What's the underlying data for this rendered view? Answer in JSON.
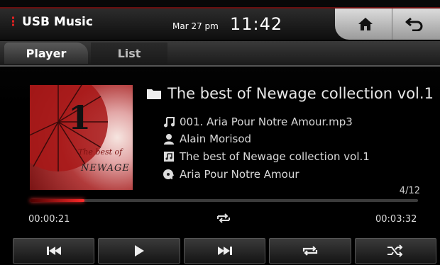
{
  "header": {
    "app_title": "USB Music",
    "date": "Mar 27 pm",
    "time": "11:42",
    "home_icon": "home-icon",
    "back_icon": "back-arrow-icon"
  },
  "tabs": [
    {
      "label": "Player",
      "active": true
    },
    {
      "label": "List",
      "active": false
    }
  ],
  "album_art": {
    "title_text": "The best of",
    "subtitle_text": "NEWAGE",
    "number_text": "1"
  },
  "track": {
    "folder": "The best of Newage collection vol.1",
    "file": "001. Aria Pour Notre Amour.mp3",
    "artist": "Alain Morisod",
    "album": "The best of Newage collection vol.1",
    "title": "Aria Pour Notre Amour",
    "counter": "4/12"
  },
  "playback": {
    "elapsed": "00:00:21",
    "total": "00:03:32",
    "progress_fraction": 0.14,
    "repeat_icon": "repeat-single-icon"
  },
  "controls": [
    {
      "name": "previous-button",
      "icon": "skip-previous-icon"
    },
    {
      "name": "play-button",
      "icon": "play-icon"
    },
    {
      "name": "next-button",
      "icon": "skip-next-icon"
    },
    {
      "name": "repeat-button",
      "icon": "repeat-icon"
    },
    {
      "name": "shuffle-button",
      "icon": "shuffle-icon"
    }
  ],
  "colors": {
    "accent": "#ff2a2a",
    "background": "#000000"
  }
}
